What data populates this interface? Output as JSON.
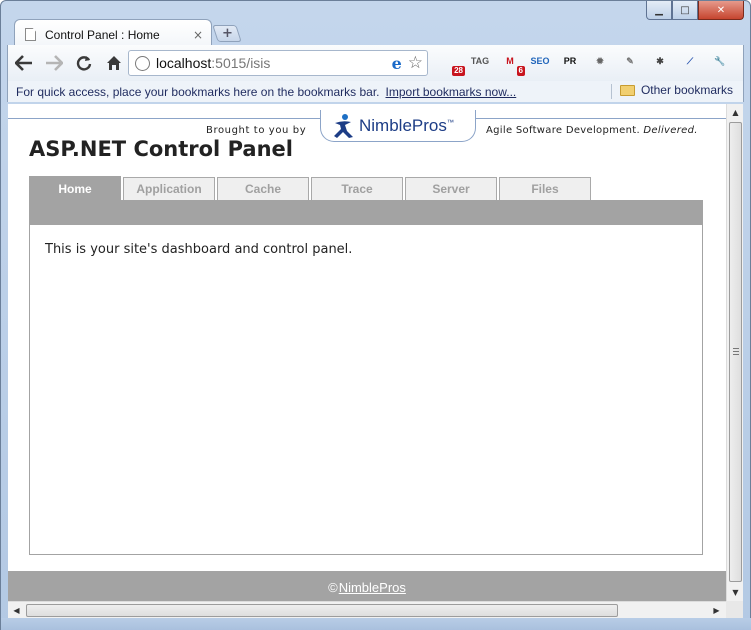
{
  "window": {
    "minimize_glyph": "▁",
    "maximize_glyph": "□",
    "close_glyph": "✕"
  },
  "tab": {
    "title": "Control Panel : Home",
    "close_glyph": "×"
  },
  "newtab_glyph": "+",
  "toolbar": {
    "url_host": "localhost",
    "url_rest": ":5015/isis",
    "ie_glyph": "e",
    "star_glyph": "☆",
    "extensions": [
      {
        "name": "rss-icon",
        "label": "",
        "badge": "28",
        "color": "#2f62c8"
      },
      {
        "name": "tag-icon",
        "label": "TAG",
        "badge": "",
        "color": "#555555"
      },
      {
        "name": "gmail-icon",
        "label": "M",
        "badge": "6",
        "color": "#c8141e"
      },
      {
        "name": "seo-icon",
        "label": "SEO",
        "badge": "",
        "color": "#2266bb"
      },
      {
        "name": "pagerank-icon",
        "label": "PR",
        "badge": "",
        "color": "#111111"
      },
      {
        "name": "gear-extension-icon",
        "label": "✹",
        "badge": "",
        "color": "#666666"
      },
      {
        "name": "note-icon",
        "label": "✎",
        "badge": "",
        "color": "#777777"
      },
      {
        "name": "bug-icon",
        "label": "✱",
        "badge": "",
        "color": "#444444"
      },
      {
        "name": "eyedropper-icon",
        "label": "⟋",
        "badge": "",
        "color": "#2a56b0"
      },
      {
        "name": "wrench-icon",
        "label": "🔧",
        "badge": "",
        "color": "#555555"
      }
    ]
  },
  "bookmarks": {
    "hint": "For quick access, place your bookmarks here on the bookmarks bar.",
    "import_link": "Import bookmarks now...",
    "other": "Other bookmarks"
  },
  "page": {
    "brought_by": "Brought to you by",
    "logo_text": "NimblePros",
    "logo_tm": "™",
    "tagline_plain": "Agile Software Development.",
    "tagline_em": "Delivered.",
    "title": "ASP.NET Control Panel",
    "tabs": [
      {
        "label": "Home",
        "active": true
      },
      {
        "label": "Application",
        "active": false
      },
      {
        "label": "Cache",
        "active": false
      },
      {
        "label": "Trace",
        "active": false
      },
      {
        "label": "Server",
        "active": false
      },
      {
        "label": "Files",
        "active": false
      }
    ],
    "body_text": "This is your site's dashboard and control panel.",
    "footer_copy": "©",
    "footer_link": "NimblePros"
  },
  "colors": {
    "tab_active": "#a3a3a3",
    "tab_inactive_text": "#a0a0a0",
    "logo_blue": "#1d3d86"
  }
}
